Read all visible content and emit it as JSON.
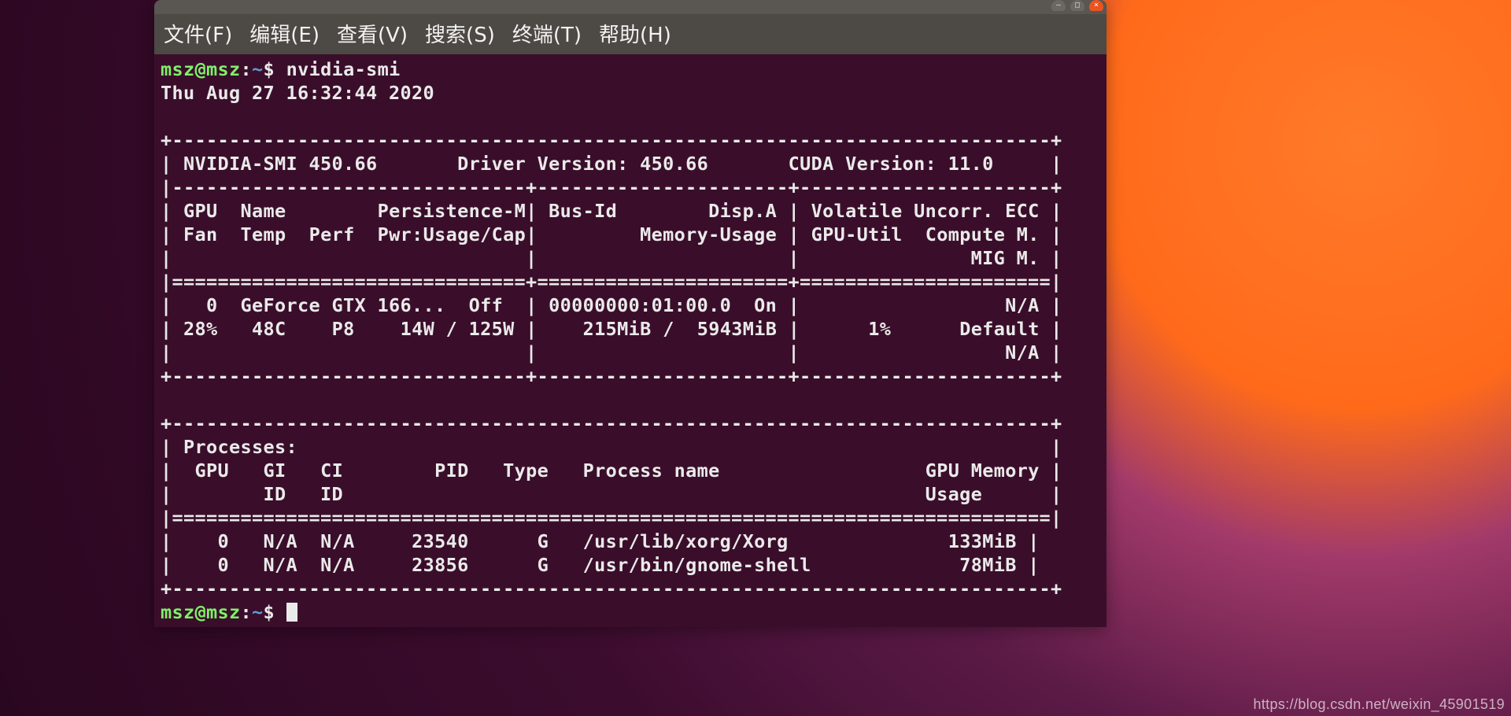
{
  "menubar": {
    "file": "文件(F)",
    "edit": "编辑(E)",
    "view": "查看(V)",
    "search": "搜索(S)",
    "terminal": "终端(T)",
    "help": "帮助(H)"
  },
  "prompt": {
    "userhost": "msz@msz",
    "sep": ":",
    "cwd": "~",
    "sigil": "$ "
  },
  "command": "nvidia-smi",
  "nvidia_smi": {
    "timestamp": "Thu Aug 27 16:32:44 2020",
    "header": {
      "smi_version_label": "NVIDIA-SMI",
      "smi_version": "450.66",
      "driver_version_label": "Driver Version:",
      "driver_version": "450.66",
      "cuda_version_label": "CUDA Version:",
      "cuda_version": "11.0"
    },
    "col_labels": {
      "gpu": "GPU",
      "name": "Name",
      "persistence": "Persistence-M",
      "fan": "Fan",
      "temp": "Temp",
      "perf": "Perf",
      "pwr": "Pwr:Usage/Cap",
      "busid": "Bus-Id",
      "dispa": "Disp.A",
      "memusage": "Memory-Usage",
      "volatile": "Volatile Uncorr. ECC",
      "gpuutil": "GPU-Util",
      "compute": "Compute M.",
      "mig": "MIG M."
    },
    "gpu": {
      "index": "0",
      "name": "GeForce GTX 166...",
      "persistence": "Off",
      "fan": "28%",
      "temp": "48C",
      "perf": "P8",
      "pwr_usage": "14W",
      "pwr_cap": "125W",
      "bus_id": "00000000:01:00.0",
      "disp_a": "On",
      "mem_used": "215MiB",
      "mem_total": "5943MiB",
      "ecc": "N/A",
      "gpu_util": "1%",
      "compute_mode": "Default",
      "mig_mode": "N/A"
    },
    "proc_labels": {
      "title": "Processes:",
      "gpu": "GPU",
      "gi": "GI",
      "ci": "CI",
      "pid": "PID",
      "type": "Type",
      "name": "Process name",
      "mem": "GPU Memory",
      "id": "ID",
      "usage": "Usage"
    },
    "processes": [
      {
        "gpu": "0",
        "gi": "N/A",
        "ci": "N/A",
        "pid": "23540",
        "type": "G",
        "name": "/usr/lib/xorg/Xorg",
        "mem": "133MiB"
      },
      {
        "gpu": "0",
        "gi": "N/A",
        "ci": "N/A",
        "pid": "23856",
        "type": "G",
        "name": "/usr/bin/gnome-shell",
        "mem": "78MiB"
      }
    ]
  },
  "watermark": "https://blog.csdn.net/weixin_45901519"
}
